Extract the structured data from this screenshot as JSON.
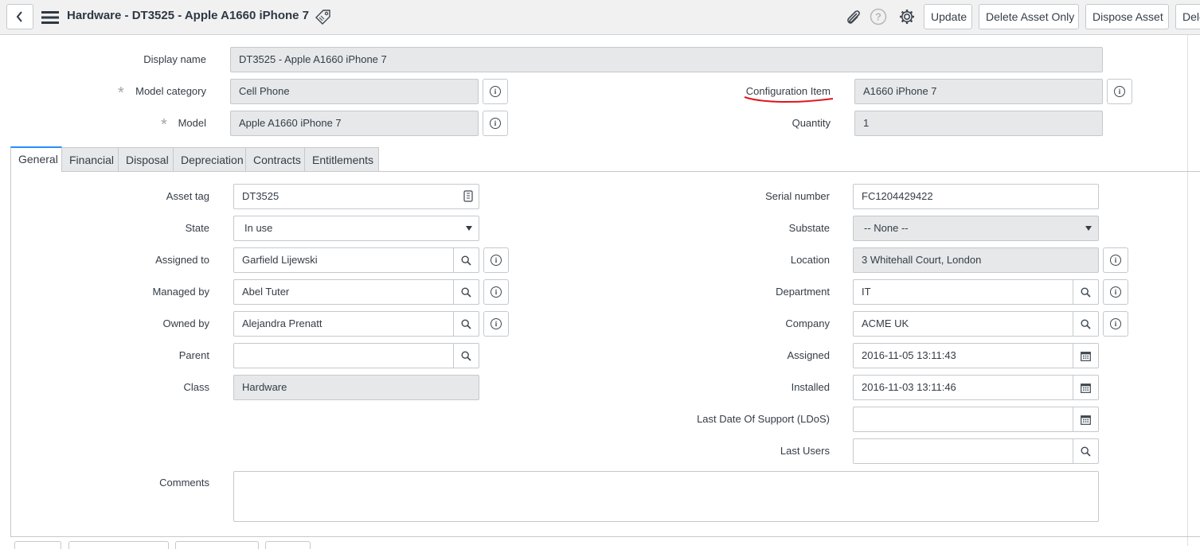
{
  "header": {
    "title": "Hardware - DT3525 - Apple A1660 iPhone 7",
    "buttons": {
      "update": "Update",
      "delete_asset_only": "Delete Asset Only",
      "dispose_asset": "Dispose Asset",
      "delete_partial": "Dele"
    }
  },
  "top_fields": {
    "display_name": {
      "label": "Display name",
      "value": "DT3525 - Apple A1660 iPhone 7"
    },
    "model_category": {
      "label": "Model category",
      "value": "Cell Phone"
    },
    "model": {
      "label": "Model",
      "value": "Apple A1660 iPhone 7"
    },
    "configuration_item": {
      "label": "Configuration Item",
      "value": "A1660 iPhone 7"
    },
    "quantity": {
      "label": "Quantity",
      "value": "1"
    }
  },
  "tabs": [
    "General",
    "Financial",
    "Disposal",
    "Depreciation",
    "Contracts",
    "Entitlements"
  ],
  "general": {
    "left": {
      "asset_tag": {
        "label": "Asset tag",
        "value": "DT3525"
      },
      "state": {
        "label": "State",
        "value": "In use"
      },
      "assigned_to": {
        "label": "Assigned to",
        "value": "Garfield Lijewski"
      },
      "managed_by": {
        "label": "Managed by",
        "value": "Abel Tuter"
      },
      "owned_by": {
        "label": "Owned by",
        "value": "Alejandra Prenatt"
      },
      "parent": {
        "label": "Parent",
        "value": ""
      },
      "class": {
        "label": "Class",
        "value": "Hardware"
      }
    },
    "right": {
      "serial_number": {
        "label": "Serial number",
        "value": "FC1204429422"
      },
      "substate": {
        "label": "Substate",
        "value": "-- None --"
      },
      "location": {
        "label": "Location",
        "value": "3 Whitehall Court, London"
      },
      "department": {
        "label": "Department",
        "value": "IT"
      },
      "company": {
        "label": "Company",
        "value": "ACME UK"
      },
      "assigned": {
        "label": "Assigned",
        "value": "2016-11-05 13:11:43"
      },
      "installed": {
        "label": "Installed",
        "value": "2016-11-03 13:11:46"
      },
      "last_date_of_support": {
        "label": "Last Date Of Support (LDoS)",
        "value": ""
      },
      "last_users": {
        "label": "Last Users",
        "value": ""
      }
    },
    "comments": {
      "label": "Comments",
      "value": ""
    }
  },
  "colors": {
    "accent": "#278efc",
    "annotation": "#e0161b",
    "readonly_bg": "#e6e8ea"
  }
}
